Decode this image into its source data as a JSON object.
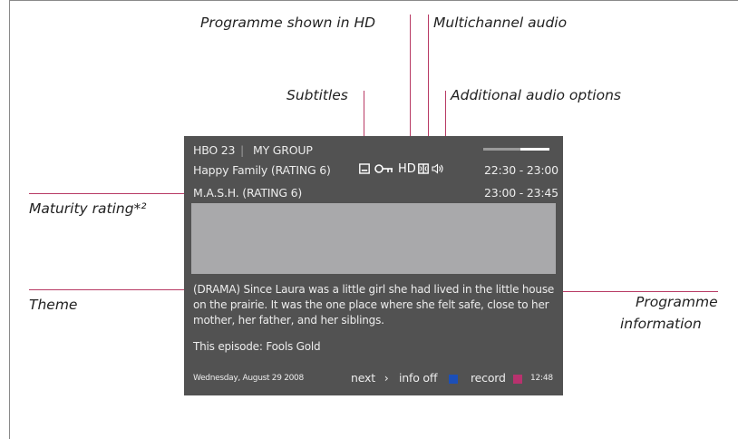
{
  "callouts": {
    "hd": "Programme shown in HD",
    "multichannel": "Multichannel audio",
    "subtitles": "Subtitles",
    "additional_audio": "Additional audio options",
    "maturity": "Maturity rating*²",
    "theme": "Theme",
    "programme_info_line1": "Programme",
    "programme_info_line2": "information"
  },
  "osd": {
    "channel": "HBO 23",
    "separator": "|",
    "group": "MY GROUP",
    "current_programme": "Happy Family (RATING 6)",
    "current_time": "22:30 - 23:00",
    "next_programme": "M.A.S.H. (RATING 6)",
    "next_time": "23:00 - 23:45",
    "hd_label": "HD",
    "progress_fraction": 0.56,
    "description": "(DRAMA) Since Laura was a little girl she had lived in the little house on the prairie. It was the one place where she felt safe, close to her mother, her father, and her siblings.",
    "episode": "This episode: Fools Gold",
    "date": "Wednesday, August 29 2008",
    "next_label": "next",
    "next_arrow": "›",
    "info_off_label": "info off",
    "record_label": "record",
    "clock": "12:48"
  },
  "icons": {
    "subtitles": "subtitles-icon",
    "maturity": "key-icon",
    "hd": "hd-icon",
    "multichannel": "dolby-icon",
    "audio": "speaker-icon",
    "blue_button": "blue-button-icon",
    "red_button": "red-button-icon"
  },
  "colors": {
    "osd_background": "#525252",
    "leader_line": "#b83a64",
    "blue_key": "#1c4fb8",
    "red_key": "#b8326e"
  }
}
